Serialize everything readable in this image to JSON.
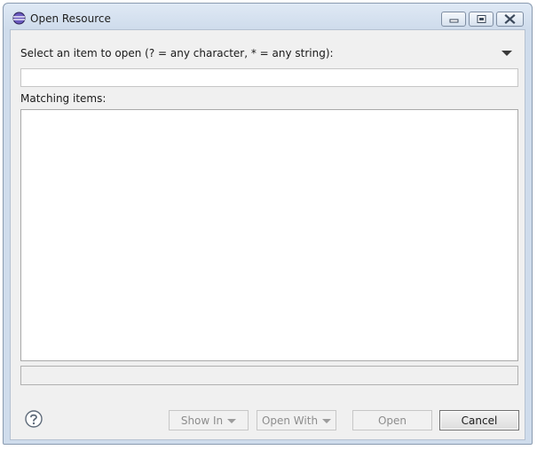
{
  "window": {
    "title": "Open Resource",
    "icon": "eclipse-logo-icon",
    "controls": [
      "minimize-icon",
      "maximize-icon",
      "close-icon"
    ]
  },
  "prompt": {
    "label": "Select an item to open (? = any character, * = any string):",
    "value": ""
  },
  "view_menu_icon": "triangle-down-icon",
  "matching": {
    "label": "Matching items:",
    "items": []
  },
  "details": "",
  "buttons": {
    "help_icon": "question-mark-icon",
    "show_in": "Show In",
    "open_with": "Open With",
    "open": "Open",
    "cancel": "Cancel"
  }
}
